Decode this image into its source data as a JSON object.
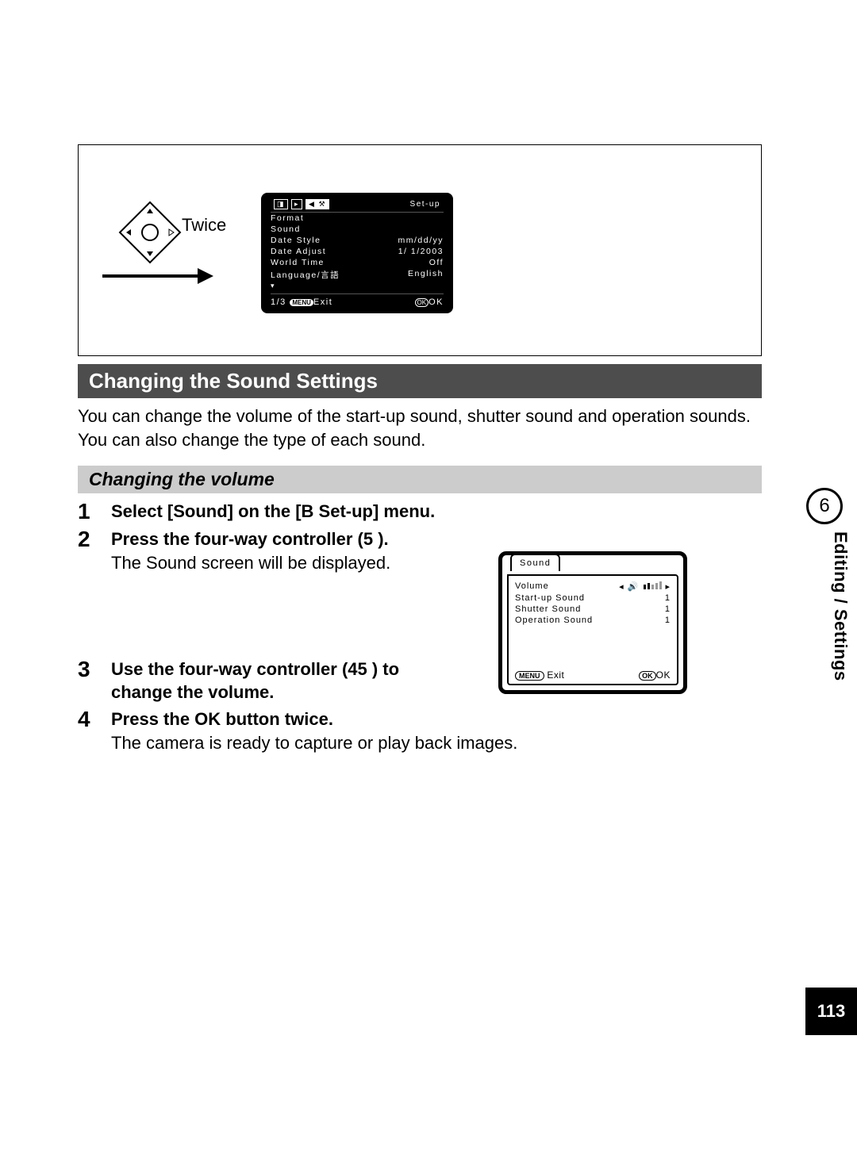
{
  "sideTab": {
    "chapter": "6",
    "label": "Editing / Settings",
    "pageNum": "113"
  },
  "figure": {
    "twice": "Twice",
    "setup": {
      "title": "Set-up",
      "rows": [
        {
          "l": "Format",
          "r": ""
        },
        {
          "l": "Sound",
          "r": ""
        },
        {
          "l": "Date Style",
          "r": "mm/dd/yy"
        },
        {
          "l": "Date Adjust",
          "r": "1/ 1/2003"
        },
        {
          "l": "World Time",
          "r": "Off"
        },
        {
          "l": "Language/言語",
          "r": "English"
        }
      ],
      "footLeft": "1/3",
      "menu": "MENU",
      "exit": "Exit",
      "ok": "OK",
      "okLabel": "OK"
    }
  },
  "sectionTitle": "Changing the Sound Settings",
  "intro": "You can change the volume of the start-up sound, shutter sound and operation sounds. You can also change the type of each sound.",
  "subTitle": "Changing the volume",
  "steps": [
    {
      "n": "1",
      "head": "Select [Sound] on the [B  Set-up] menu.",
      "desc": ""
    },
    {
      "n": "2",
      "head": "Press the four-way controller (5  ).",
      "desc": "The Sound screen will be displayed."
    },
    {
      "n": "3",
      "head": "Use the four-way controller (45   ) to change the volume.",
      "desc": ""
    },
    {
      "n": "4",
      "head": "Press the OK button twice.",
      "desc": "The camera is ready to capture or play back images."
    }
  ],
  "soundScreen": {
    "tab": "Sound",
    "rows": [
      {
        "l": "Volume",
        "r": ""
      },
      {
        "l": "Start-up Sound",
        "r": "1"
      },
      {
        "l": "Shutter Sound",
        "r": "1"
      },
      {
        "l": "Operation Sound",
        "r": "1"
      }
    ],
    "menu": "MENU",
    "exit": "Exit",
    "ok": "OK",
    "okLabel": "OK"
  }
}
